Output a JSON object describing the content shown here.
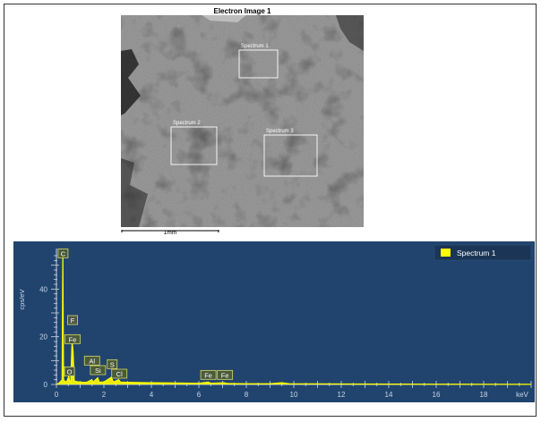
{
  "electron_image": {
    "title": "Electron Image 1",
    "scale_label": "1mm",
    "regions": [
      {
        "label": "Spectrum 1"
      },
      {
        "label": "Spectrum 2"
      },
      {
        "label": "Spectrum 3"
      }
    ]
  },
  "chart_data": {
    "type": "line",
    "title": "",
    "xlabel": "keV",
    "ylabel": "cps/eV",
    "xlim": [
      0,
      20
    ],
    "ylim": [
      -2,
      57
    ],
    "x_ticks": [
      0,
      2,
      4,
      6,
      8,
      10,
      12,
      14,
      16,
      18
    ],
    "y_ticks": [
      0,
      20,
      40
    ],
    "grid": false,
    "legend_position": "top-right",
    "background_color": "#21446e",
    "series": [
      {
        "name": "Spectrum 1",
        "color": "#ffff00",
        "points": [
          [
            0.0,
            0
          ],
          [
            0.1,
            0.5
          ],
          [
            0.2,
            1.5
          ],
          [
            0.24,
            2
          ],
          [
            0.27,
            56
          ],
          [
            0.3,
            2
          ],
          [
            0.38,
            1
          ],
          [
            0.45,
            1.5
          ],
          [
            0.52,
            3.5
          ],
          [
            0.55,
            1.5
          ],
          [
            0.6,
            1
          ],
          [
            0.66,
            18
          ],
          [
            0.7,
            14
          ],
          [
            0.75,
            1.5
          ],
          [
            0.85,
            1.2
          ],
          [
            1.0,
            1
          ],
          [
            1.2,
            0.9
          ],
          [
            1.3,
            1
          ],
          [
            1.49,
            2
          ],
          [
            1.55,
            1
          ],
          [
            1.74,
            2.8
          ],
          [
            1.8,
            1
          ],
          [
            2.0,
            1
          ],
          [
            2.31,
            3
          ],
          [
            2.4,
            1
          ],
          [
            2.62,
            2
          ],
          [
            2.7,
            1
          ],
          [
            3.0,
            0.9
          ],
          [
            4.0,
            0.7
          ],
          [
            5.0,
            0.6
          ],
          [
            6.0,
            0.5
          ],
          [
            6.4,
            1
          ],
          [
            6.5,
            0.5
          ],
          [
            7.06,
            0.7
          ],
          [
            7.2,
            0.4
          ],
          [
            8.0,
            0.3
          ],
          [
            9.0,
            0.3
          ],
          [
            9.5,
            0.7
          ],
          [
            9.8,
            0.3
          ],
          [
            12,
            0.2
          ],
          [
            16,
            0.1
          ],
          [
            20,
            0.05
          ]
        ]
      }
    ],
    "peak_labels": [
      {
        "label": "C",
        "x": 0.28,
        "y": 55
      },
      {
        "label": "F",
        "x": 0.68,
        "y": 27
      },
      {
        "label": "Fe",
        "x": 0.68,
        "y": 19
      },
      {
        "label": "O",
        "x": 0.55,
        "y": 5.5
      },
      {
        "label": "Al",
        "x": 1.5,
        "y": 10
      },
      {
        "label": "Si",
        "x": 1.75,
        "y": 6
      },
      {
        "label": "S",
        "x": 2.35,
        "y": 8.5
      },
      {
        "label": "Cl",
        "x": 2.65,
        "y": 4.5
      },
      {
        "label": "Fe",
        "x": 6.4,
        "y": 4
      },
      {
        "label": "Fe",
        "x": 7.1,
        "y": 4
      }
    ]
  }
}
